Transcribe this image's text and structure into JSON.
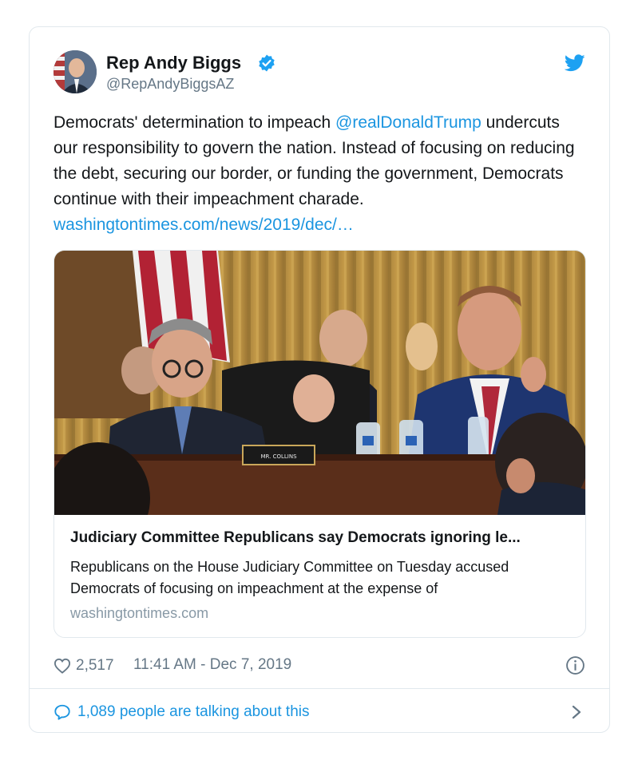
{
  "author": {
    "name": "Rep Andy Biggs",
    "handle": "@RepAndyBiggsAZ",
    "verified": true
  },
  "tweet": {
    "text_before_mention": "Democrats' determination to impeach ",
    "mention": "@realDonaldTrump",
    "text_after_mention": " undercuts our responsibility to govern the nation. Instead of focusing on reducing the debt, securing our border, or funding the government, Democrats continue with their impeachment charade. ",
    "link": "washingtontimes.com/news/2019/dec/…"
  },
  "link_card": {
    "title": "Judiciary Committee Republicans say Democrats ignoring le...",
    "description": "Republicans on the House Judiciary Committee on Tuesday accused Democrats of focusing on impeachment at the expense of",
    "domain": "washingtontimes.com",
    "nameplate_text": "MR. COLLINS"
  },
  "footer": {
    "likes": "2,517",
    "timestamp": "11:41 AM - Dec 7, 2019",
    "talking": "1,089 people are talking about this"
  },
  "icons": {
    "verified": "verified-badge-icon",
    "brand": "twitter-bird-icon",
    "like": "heart-icon",
    "info": "info-icon",
    "reply": "speech-bubble-icon",
    "more": "chevron-right-icon"
  },
  "colors": {
    "link_blue": "#1b95e0",
    "verified_blue": "#1da1f2",
    "secondary_text": "#657786",
    "border": "#e1e8ed"
  }
}
